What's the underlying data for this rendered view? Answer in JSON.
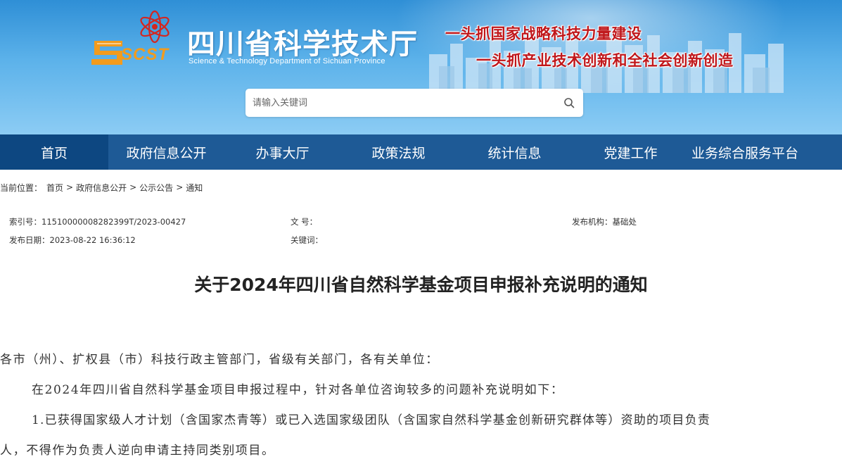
{
  "header": {
    "logo_text": "SCST",
    "title_cn": "四川省科学技术厅",
    "title_en": "Science & Technology Department of Sichuan Province",
    "slogan_1": "一头抓国家战略科技力量建设",
    "slogan_2": "一头抓产业技术创新和全社会创新创造"
  },
  "search": {
    "placeholder": "请输入关键词",
    "icon": "search-icon"
  },
  "nav": {
    "items": [
      {
        "label": "首页",
        "active": true
      },
      {
        "label": "政府信息公开"
      },
      {
        "label": "办事大厅"
      },
      {
        "label": "政策法规"
      },
      {
        "label": "统计信息"
      },
      {
        "label": "党建工作"
      },
      {
        "label": "业务综合服务平台"
      }
    ]
  },
  "breadcrumb": {
    "prefix": "当前位置：",
    "items": [
      "首页",
      "政府信息公开",
      "公示公告",
      "通知"
    ],
    "separator": ">"
  },
  "meta": {
    "index_label": "索引号：",
    "index_value": "11510000008282399T/2023-00427",
    "doc_no_label": "文 号：",
    "doc_no_value": "",
    "publisher_label": "发布机构：",
    "publisher_value": "基础处",
    "date_label": "发布日期：",
    "date_value": "2023-08-22 16:36:12",
    "keywords_label": "关键词：",
    "keywords_value": ""
  },
  "article": {
    "title": "关于2024年四川省自然科学基金项目申报补充说明的通知",
    "salutation": "各市（州）、扩权县（市）科技行政主管部门，省级有关部门，各有关单位：",
    "intro": "在2024年四川省自然科学基金项目申报过程中，针对各单位咨询较多的问题补充说明如下：",
    "item1_line1": "1.已获得国家级人才计划（含国家杰青等）或已入选国家级团队（含国家自然科学基金创新研究群体等）资助的项目负责",
    "item1_line2": "人，不得作为负责人逆向申请主持同类别项目。"
  },
  "colors": {
    "nav_bg": "#1e5a96",
    "nav_active_bg": "#0d4781",
    "slogan": "#c0171b",
    "banner": "#5cb2ea"
  }
}
